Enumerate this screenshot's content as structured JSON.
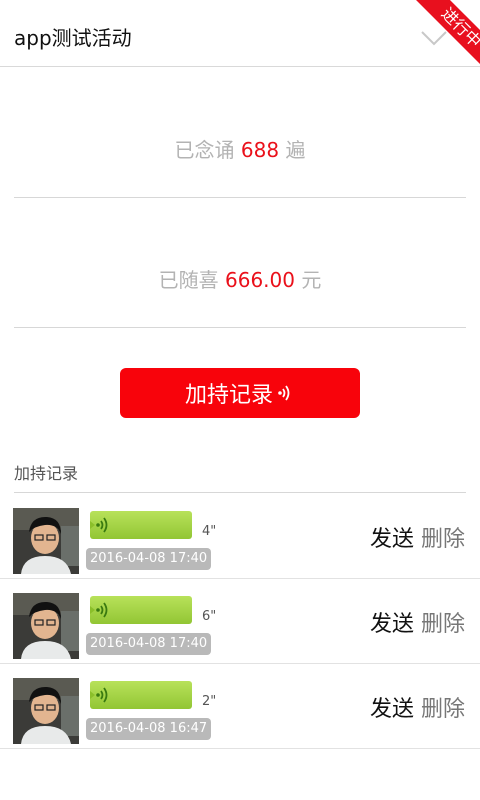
{
  "header": {
    "title": "app测试活动",
    "status_ribbon": "进行中",
    "expand_icon": "chevron-down-icon"
  },
  "stats": {
    "chant": {
      "prefix": "已念诵",
      "value": "688",
      "suffix": "遍"
    },
    "donation": {
      "prefix": "已随喜",
      "value": "666.00",
      "suffix": "元"
    }
  },
  "main_button": {
    "label": "加持记录",
    "icon": "sound-wave-icon"
  },
  "records": {
    "section_title": "加持记录",
    "send_label": "发送",
    "delete_label": "删除",
    "items": [
      {
        "duration": "4\"",
        "timestamp": "2016-04-08 17:40"
      },
      {
        "duration": "6\"",
        "timestamp": "2016-04-08 17:40"
      },
      {
        "duration": "2\"",
        "timestamp": "2016-04-08 16:47"
      }
    ]
  },
  "colors": {
    "accent_red": "#f8030b",
    "value_red": "#ea101a",
    "voice_green": "#a4d43f",
    "muted_text": "#b3b3b3"
  }
}
